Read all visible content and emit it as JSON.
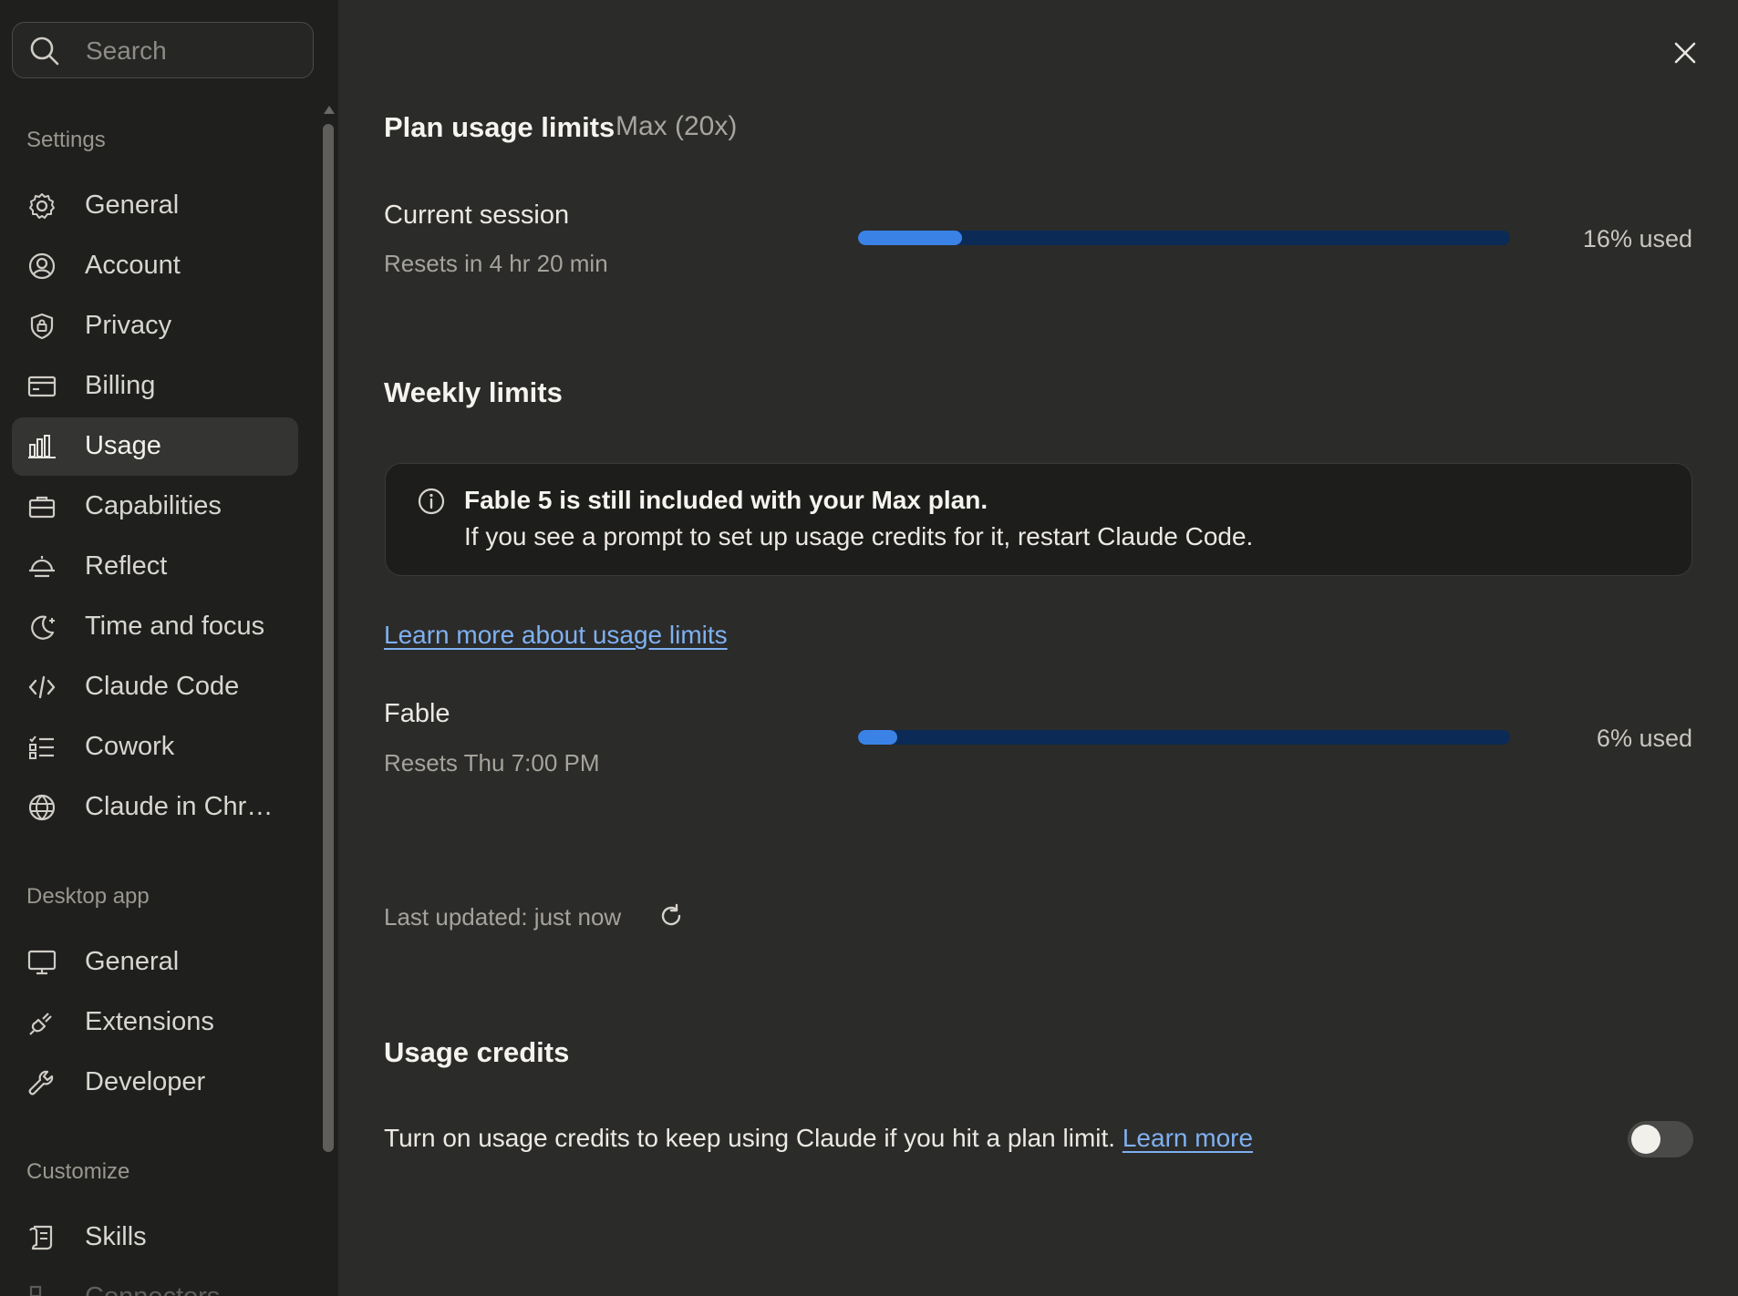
{
  "search": {
    "placeholder": "Search"
  },
  "sidebar": {
    "settings_label": "Settings",
    "settings_items": [
      {
        "label": "General",
        "icon": "gear-icon"
      },
      {
        "label": "Account",
        "icon": "user-circle-icon"
      },
      {
        "label": "Privacy",
        "icon": "shield-lock-icon"
      },
      {
        "label": "Billing",
        "icon": "credit-card-icon"
      },
      {
        "label": "Usage",
        "icon": "bar-chart-icon",
        "active": true
      },
      {
        "label": "Capabilities",
        "icon": "toolbox-icon"
      },
      {
        "label": "Reflect",
        "icon": "sunset-icon"
      },
      {
        "label": "Time and focus",
        "icon": "moon-icon"
      },
      {
        "label": "Claude Code",
        "icon": "code-icon"
      },
      {
        "label": "Cowork",
        "icon": "checklist-icon"
      },
      {
        "label": "Claude in Chr…",
        "icon": "globe-icon"
      }
    ],
    "desktop_label": "Desktop app",
    "desktop_items": [
      {
        "label": "General",
        "icon": "monitor-icon"
      },
      {
        "label": "Extensions",
        "icon": "plug-icon"
      },
      {
        "label": "Developer",
        "icon": "wrench-icon"
      }
    ],
    "customize_label": "Customize",
    "customize_items": [
      {
        "label": "Skills",
        "icon": "scroll-icon"
      },
      {
        "label": "Connectors",
        "icon": "connectors-icon"
      }
    ]
  },
  "main": {
    "plan_title": "Plan usage limits",
    "plan_name": "Max (20x)",
    "session": {
      "title": "Current session",
      "reset": "Resets in 4 hr 20 min",
      "percent": 16,
      "percent_label": "16% used"
    },
    "weekly_title": "Weekly limits",
    "info": {
      "bold": "Fable 5 is still included with your Max plan.",
      "text": "If you see a prompt to set up usage credits for it, restart Claude Code."
    },
    "learn_link": "Learn more about usage limits",
    "fable": {
      "title": "Fable",
      "reset": "Resets Thu 7:00 PM",
      "percent": 6,
      "percent_label": "6% used"
    },
    "last_updated": "Last updated: just now",
    "credits_title": "Usage credits",
    "credits_text": "Turn on usage credits to keep using Claude if you hit a plan limit.",
    "credits_link": "Learn more",
    "credits_enabled": false
  },
  "colors": {
    "accent": "#3b82e6",
    "bar_track": "#0b2a55",
    "link": "#7fb0f0",
    "background": "#2b2b2a",
    "sidebar": "#1f1f1e"
  }
}
